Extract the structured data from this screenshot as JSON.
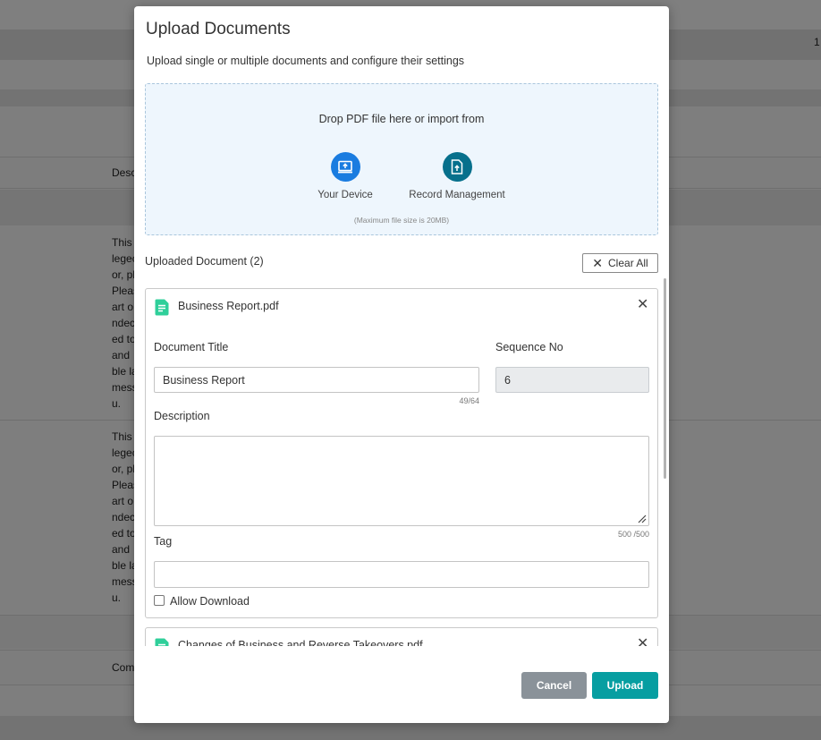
{
  "background": {
    "header_number": "1",
    "desc_label": "Desc",
    "comments_label": "Com",
    "row1_lines": [
      "This",
      "legec",
      "or, pl",
      "Pleas",
      "art o",
      "ndec",
      "ed to",
      "and ",
      "ble la",
      "mess",
      "u."
    ],
    "row2_lines": [
      "This",
      "legec",
      "or, pl",
      "Pleas",
      "art o",
      "ndec",
      "ed to",
      "and ",
      "ble la",
      "mess",
      "u."
    ]
  },
  "modal": {
    "title": "Upload Documents",
    "subtitle": "Upload single or multiple documents and configure their settings",
    "dropzone": {
      "text": "Drop PDF file here or import from",
      "sources": [
        {
          "label": "Your Device",
          "icon": "device-upload-icon",
          "color": "#1a7ce0"
        },
        {
          "label": "Record Management",
          "icon": "file-upload-icon",
          "color": "#07708c"
        }
      ],
      "max_size": "(Maximum file size is 20MB)"
    },
    "uploaded_heading": "Uploaded Document (2)",
    "clear_all": "Clear All",
    "documents": [
      {
        "file_name": "Business Report.pdf",
        "title_label": "Document Title",
        "title_value": "Business Report",
        "title_counter": "49/64",
        "sequence_label": "Sequence No",
        "sequence_value": "6",
        "description_label": "Description",
        "description_value": "",
        "description_counter": "500 /500",
        "tag_label": "Tag",
        "tag_value": "",
        "allow_download_label": "Allow Download",
        "allow_download": false
      },
      {
        "file_name": "Changes of Business and Reverse Takeovers.pdf"
      }
    ],
    "cancel": "Cancel",
    "upload": "Upload"
  },
  "colors": {
    "primary": "#079ea1",
    "device_icon": "#1a7ce0",
    "record_icon": "#07708c",
    "doc_icon": "#2fcf9a",
    "cancel": "#8a9299"
  }
}
